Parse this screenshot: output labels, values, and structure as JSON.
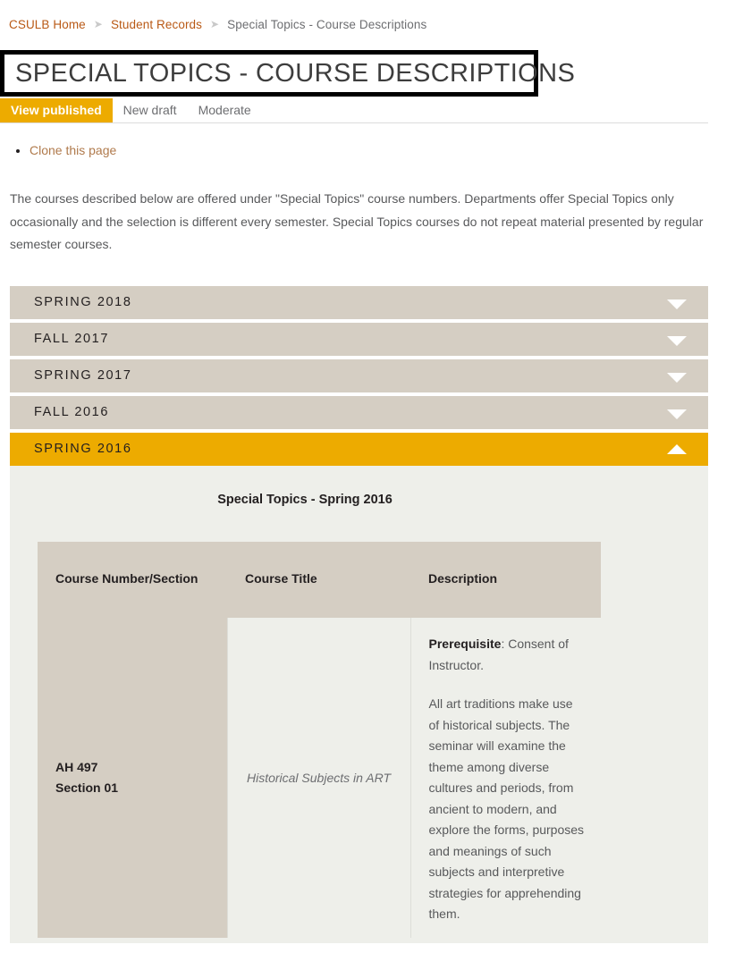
{
  "breadcrumb": {
    "items": [
      {
        "label": "CSULB Home",
        "current": false
      },
      {
        "label": "Student Records",
        "current": false
      },
      {
        "label": "Special Topics - Course Descriptions",
        "current": true
      }
    ],
    "separator_icon": "chevron-right-icon"
  },
  "page": {
    "title": "SPECIAL TOPICS - COURSE DESCRIPTIONS"
  },
  "tabs": [
    {
      "label": "View published",
      "active": true
    },
    {
      "label": "New draft",
      "active": false
    },
    {
      "label": "Moderate",
      "active": false
    }
  ],
  "actions": {
    "clone_label": "Clone this page"
  },
  "intro": {
    "text": "The courses described below are offered under \"Special Topics\" course numbers. Departments offer Special Topics only occasionally and the selection is different every semester. Special Topics courses do not repeat material presented by regular semester courses."
  },
  "accordion": {
    "items": [
      {
        "label": "SPRING 2018",
        "open": false,
        "icon": "chevron-down-icon"
      },
      {
        "label": "FALL 2017",
        "open": false,
        "icon": "chevron-down-icon"
      },
      {
        "label": "SPRING 2017",
        "open": false,
        "icon": "chevron-down-icon"
      },
      {
        "label": "FALL 2016",
        "open": false,
        "icon": "chevron-down-icon"
      },
      {
        "label": "SPRING 2016",
        "open": true,
        "icon": "chevron-up-icon"
      }
    ]
  },
  "panel": {
    "title": "Special Topics - Spring 2016",
    "table": {
      "headers": [
        "Course Number/Section",
        "Course Title",
        "Description"
      ],
      "rows": [
        {
          "course_number": "AH 497",
          "course_section": "Section 01",
          "course_title": "Historical Subjects in ART",
          "description_prereq_label": "Prerequisite",
          "description_prereq_value": ": Consent of Instructor.",
          "description_body": "All art traditions make use of historical subjects. The seminar will examine the theme among diverse cultures and periods, from ancient to modern, and explore the forms, purposes and meanings of such subjects and interpretive strategies for apprehending them."
        }
      ]
    }
  },
  "colors": {
    "accent_orange": "#edab00",
    "accordion_beige": "#d5cec3",
    "panel_bg": "#eeefea",
    "link_orange": "#b95915",
    "body_text": "#58595b"
  }
}
